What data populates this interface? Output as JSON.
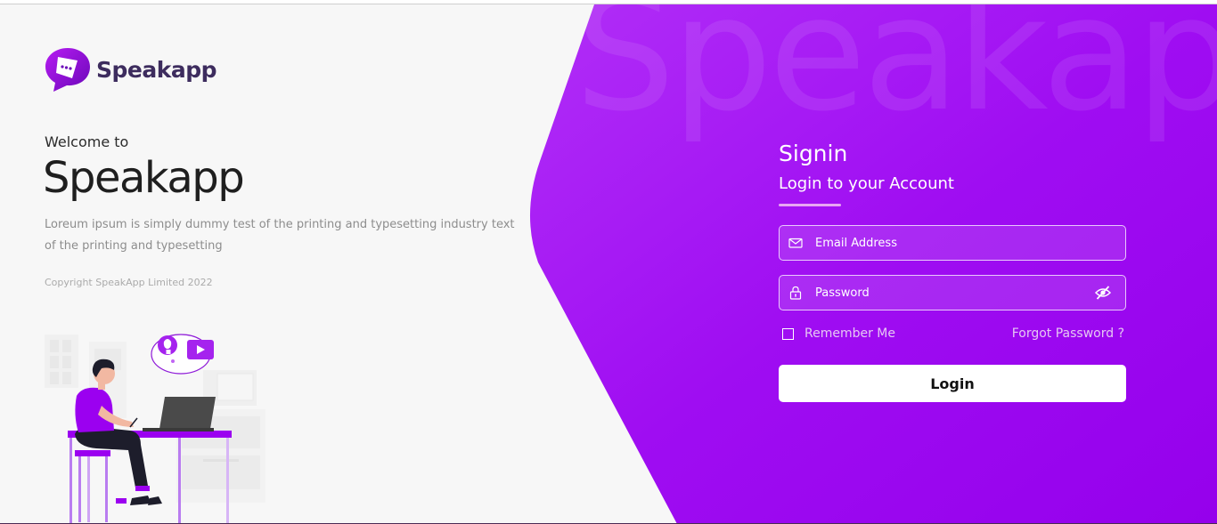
{
  "brand": {
    "name": "Speakapp",
    "text_color": "#3d2c5e"
  },
  "left": {
    "welcome": "Welcome to",
    "title": "Speakapp",
    "description": "Loreum ipsum is simply dummy test of the printing and typesetting industry text of the printing and typesetting",
    "copyright": "Copyright SpeakApp Limited 2022"
  },
  "watermark": "Speakapp",
  "form": {
    "title": "Signin",
    "subtitle": "Login to your Account",
    "email_placeholder": "Email Address",
    "password_placeholder": "Password",
    "remember_label": "Remember Me",
    "forgot_label": "Forgot Password ?",
    "login_label": "Login"
  },
  "icons": {
    "logo": "chat-bubble-play-icon",
    "email": "envelope-icon",
    "password": "lock-icon",
    "visibility": "eye-off-icon"
  },
  "colors": {
    "accent": "#9b00f0",
    "accent_light": "#b12ef7",
    "underline": "#e8a6f3",
    "left_bg": "#f8f8f8"
  }
}
